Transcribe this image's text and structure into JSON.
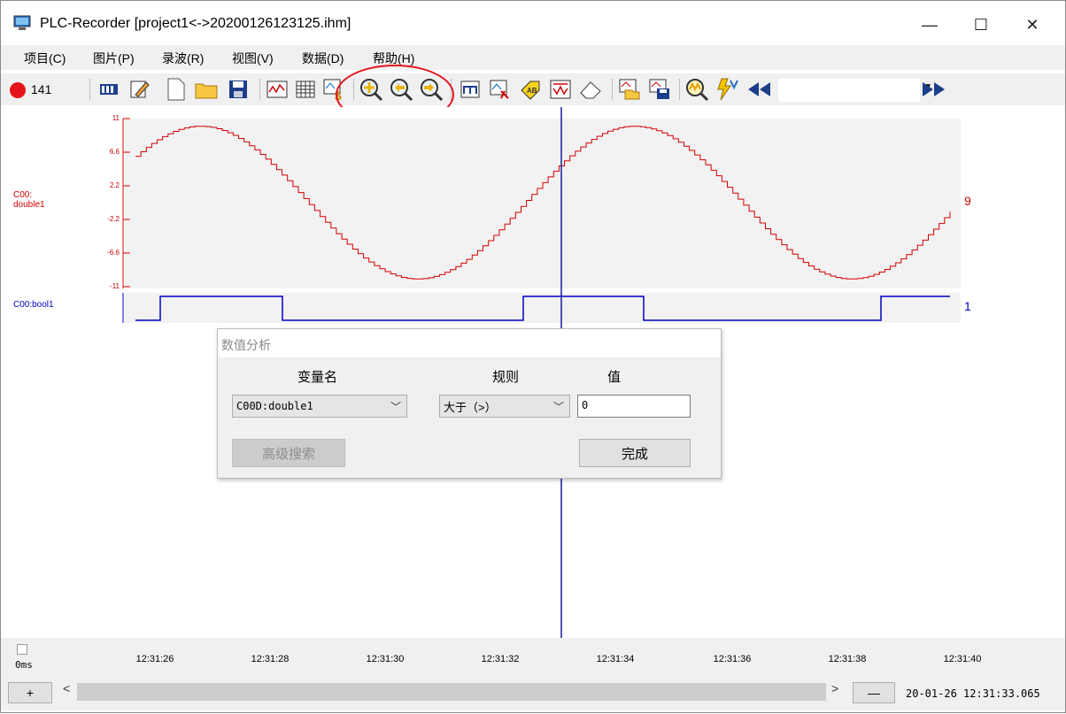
{
  "window": {
    "title": "PLC-Recorder  [project1<->20200126123125.ihm]",
    "controls": {
      "minimize": "—",
      "maximize": "☐",
      "close": "✕"
    }
  },
  "menu": [
    "项目(C)",
    "图片(P)",
    "录波(R)",
    "视图(V)",
    "数据(D)",
    "帮助(H)"
  ],
  "toolbar": {
    "record_count": "141",
    "icons": [
      "database-icon",
      "edit-icon",
      "new-file-icon",
      "open-folder-icon",
      "save-icon",
      "waveform-icon",
      "grid-icon",
      "dollar-wave-icon",
      "zoom-in-icon",
      "zoom-back-icon",
      "zoom-forward-icon",
      "time-range-icon",
      "cursor-wave-icon",
      "tag-icon",
      "chart-icon",
      "eraser-icon",
      "export-icon",
      "save-export-icon",
      "search-wave-icon",
      "lightning-icon",
      "rewind-icon",
      "fast-forward-icon"
    ],
    "combo_value": ""
  },
  "channels": [
    {
      "label": "C00:\ndouble1",
      "right_value": "9",
      "color": "#d40000",
      "ticks": [
        "11",
        "6.6",
        "2.2",
        "-2.2",
        "-6.6",
        "-11"
      ]
    },
    {
      "label": "C00:bool1",
      "right_value": "1",
      "color": "#0000c8"
    }
  ],
  "timeline": {
    "labels": [
      "12:31:26",
      "12:31:28",
      "12:31:30",
      "12:31:32",
      "12:31:34",
      "12:31:36",
      "12:31:38",
      "12:31:40"
    ],
    "offset_label": "0ms"
  },
  "bottom": {
    "plus": "+",
    "minus": "—",
    "left_arrow": "<",
    "right_arrow": ">",
    "status_time": "20-01-26 12:31:33.065"
  },
  "dialog": {
    "title": "数值分析",
    "col_variable": "变量名",
    "col_rule": "规则",
    "col_value": "值",
    "variable_value": "C00D:double1",
    "rule_value": "大于（>）",
    "value_input": "0",
    "advanced_button": "高级搜索",
    "done_button": "完成"
  },
  "colors": {
    "accent_red": "#e4141b",
    "wave_red": "#d40000",
    "wave_blue": "#0000c8",
    "cursor": "#1a1aa0",
    "plot_bg": "#f2f2f2"
  }
}
